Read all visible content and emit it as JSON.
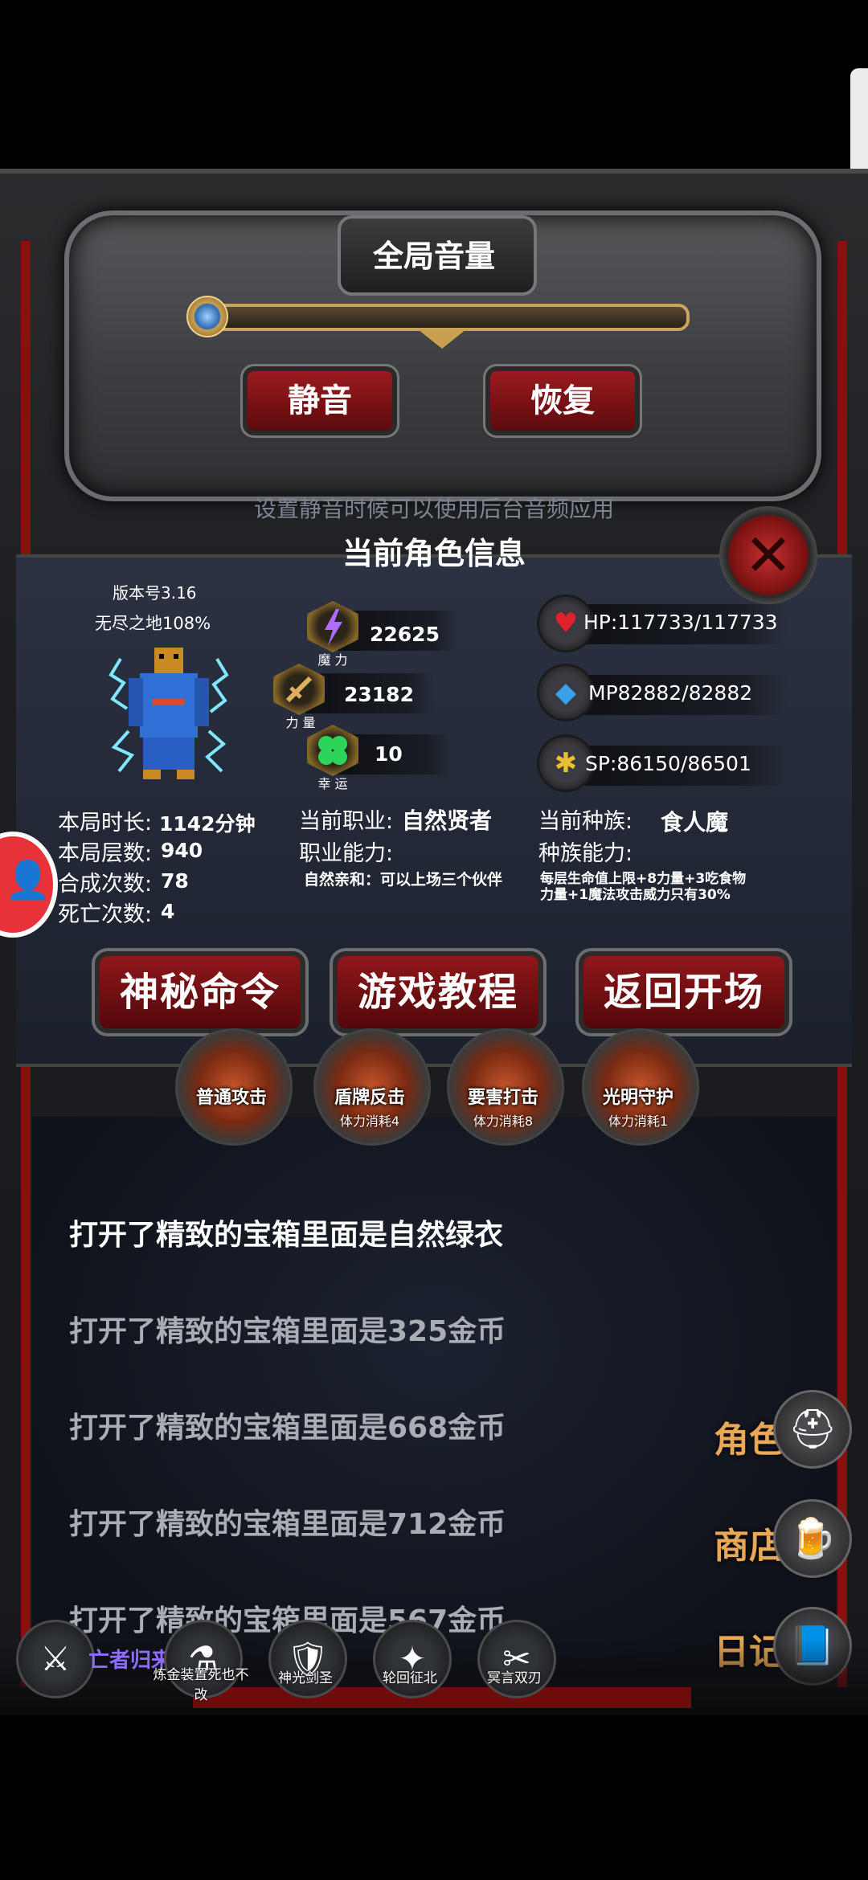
{
  "volume": {
    "title": "全局音量",
    "mute_label": "静音",
    "restore_label": "恢复",
    "hint": "设置静音时候可以使用后台音频应用"
  },
  "character": {
    "title": "当前角色信息",
    "version": "版本号3.16",
    "area": "无尽之地108%",
    "magic": {
      "label": "魔 力",
      "value": "22625"
    },
    "strength": {
      "label": "力 量",
      "value": "23182"
    },
    "luck": {
      "label": "幸 运",
      "value": "10"
    },
    "hp": "HP:117733/117733",
    "mp": "MP82882/82882",
    "sp": "SP:86150/86501",
    "session_time": {
      "label": "本局时长:",
      "value": "1142分钟"
    },
    "session_floors": {
      "label": "本局层数:",
      "value": "940"
    },
    "craft_count": {
      "label": "合成次数:",
      "value": "78"
    },
    "death_count": {
      "label": "死亡次数:",
      "value": "4"
    },
    "job": {
      "label": "当前职业:",
      "value": "自然贤者"
    },
    "job_ability_label": "职业能力:",
    "job_ability": "自然亲和：可以上场三个伙伴",
    "race": {
      "label": "当前种族:",
      "value": "食人魔"
    },
    "race_ability_label": "种族能力:",
    "race_ability": "每层生命值上限+8力量+3吃食物力量+1魔法攻击威力只有30%"
  },
  "actions": {
    "secret_command": "神秘命令",
    "tutorial": "游戏教程",
    "back_to_start": "返回开场"
  },
  "skills": [
    {
      "name": "普通攻击",
      "cost": ""
    },
    {
      "name": "盾牌反击",
      "cost": "体力消耗4"
    },
    {
      "name": "要害打击",
      "cost": "体力消耗8"
    },
    {
      "name": "光明守护",
      "cost": "体力消耗1"
    }
  ],
  "log": [
    "打开了精致的宝箱里面是自然绿衣",
    "打开了精致的宝箱里面是325金币",
    "打开了精致的宝箱里面是668金币",
    "打开了精致的宝箱里面是712金币",
    "打开了精致的宝箱里面是567金币"
  ],
  "side_menu": {
    "character": "角色",
    "shop": "商店",
    "diary": "日记"
  },
  "bottom": {
    "undead_return": "亡者归来",
    "items": [
      "炼金装置死也不改",
      "神光剑圣",
      "轮回征北",
      "冥言双刃"
    ]
  },
  "colors": {
    "accent_orange": "#e9a857",
    "button_red": "#8f181c",
    "log_active": "#ffffff",
    "log_faded": "#a9adb4"
  }
}
